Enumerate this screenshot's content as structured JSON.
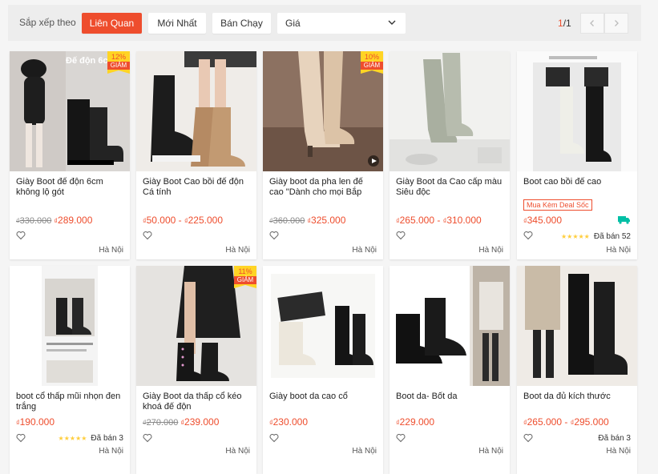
{
  "sort": {
    "label": "Sắp xếp theo",
    "options": [
      "Liên Quan",
      "Mới Nhất",
      "Bán Chạy"
    ],
    "price_label": "Giá"
  },
  "pager": {
    "current": "1",
    "total": "/1"
  },
  "colors": {
    "accent": "#ee4d2d",
    "badge": "#ffd424",
    "free_ship": "#00bfa5"
  },
  "products": [
    {
      "name": "Giày Boot đế độn 6cm không lộ gót",
      "old_price": "330.000",
      "price": "289.000",
      "discount": "12%",
      "discount_label": "GIẢM",
      "overlay_text": "Đế độn 6c",
      "location": "Hà Nội"
    },
    {
      "name": "Giày Boot Cao bồi đế độn Cá tính",
      "price": "50.000",
      "price_to": "225.000",
      "location": "Hà Nội"
    },
    {
      "name": "Giày boot da pha len đế cao \"Dành cho mọi Bắp chân\"",
      "old_price": "360.000",
      "price": "325.000",
      "discount": "10%",
      "discount_label": "GIẢM",
      "location": "Hà Nội"
    },
    {
      "name": "Giày Boot da Cao cấp màu Siêu độc",
      "price": "265.000",
      "price_to": "310.000",
      "location": "Hà Nội"
    },
    {
      "name": "Boot cao bồi đế cao",
      "deal_tag": "Mua Kèm Deal Sốc",
      "price": "345.000",
      "stars": "★★★★★",
      "sold": "Đã bán 52",
      "location": "Hà Nội"
    },
    {
      "name": "boot cổ thấp mũi nhọn đen trắng",
      "price": "190.000",
      "stars": "★★★★★",
      "sold": "Đã bán 3",
      "location": "Hà Nội"
    },
    {
      "name": "Giày Boot da thấp cổ kéo khoá đế độn",
      "old_price": "270.000",
      "price": "239.000",
      "discount": "11%",
      "discount_label": "GIẢM",
      "location": "Hà Nội"
    },
    {
      "name": "Giày boot da cao cổ",
      "price": "230.000",
      "location": "Hà Nội"
    },
    {
      "name": "Boot da- Bốt da",
      "price": "229.000",
      "location": "Hà Nội"
    },
    {
      "name": "Boot da đủ kích thước",
      "price": "265.000",
      "price_to": "295.000",
      "sold": "Đã bán 3",
      "location": "Hà Nội"
    }
  ]
}
